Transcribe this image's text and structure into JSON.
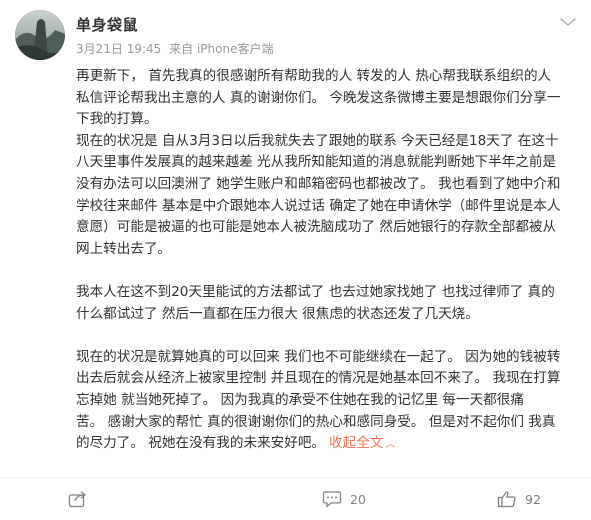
{
  "post": {
    "username": "单身袋鼠",
    "date": "3月21日 19:45",
    "source": "来自 iPhone客户端",
    "paragraphs": [
      [
        "再更新下， 首先我真的很感谢所有帮助我的人 转发的人 热心帮我联系组织的人",
        "私信评论帮我出主意的人 真的谢谢你们。 今晚发这条微博主要是想跟你们分享一",
        "下我的打算。"
      ],
      [
        "现在的状况是 自从3月3日以后我就失去了跟她的联系 今天已经是18天了 在这十",
        "八天里事件发展真的越来越差 光从我所知能知道的消息就能判断她下半年之前是",
        "没有办法可以回澳洲了 她学生账户和邮箱密码也都被改了。 我也看到了她中介和",
        "学校往来邮件 基本是中介跟她本人说过话 确定了她在申请休学（邮件里说是本人",
        "意愿）可能是被逼的也可能是她本人被洗脑成功了 然后她银行的存款全部都被从",
        "网上转出去了。"
      ],
      [
        "我本人在这不到20天里能试的方法都试了 也去过她家找她了 也找过律师了 真的",
        "什么都试过了 然后一直都在压力很大 很焦虑的状态还发了几天烧。"
      ],
      [
        "现在的状况是就算她真的可以回来 我们也不可能继续在一起了。 因为她的钱被转",
        "出去后就会从经济上被家里控制 并且现在的情况是她基本回不来了。 我现在打算",
        "忘掉她 就当她死掉了。 因为我真的承受不住她在我的记忆里 每一天都很痛",
        "苦。 感谢大家的帮忙 真的很谢谢你们的热心和感同身受。 但是对不起你们 我真",
        "的尽力了。 祝她在没有我的未来安好吧。"
      ]
    ],
    "collapse_label": "收起全文",
    "collapse_caret": "︿"
  },
  "actions": {
    "share_count": "",
    "comment_count": "20",
    "like_count": "92"
  },
  "colors": {
    "link": "#eb7350",
    "meta": "#999999",
    "text": "#333333",
    "icon": "#808080"
  },
  "icons": {
    "avatar": "avatar-photo",
    "menu": "chevron-down-icon",
    "share": "share-icon",
    "comment": "comment-icon",
    "like": "thumbs-up-icon"
  }
}
